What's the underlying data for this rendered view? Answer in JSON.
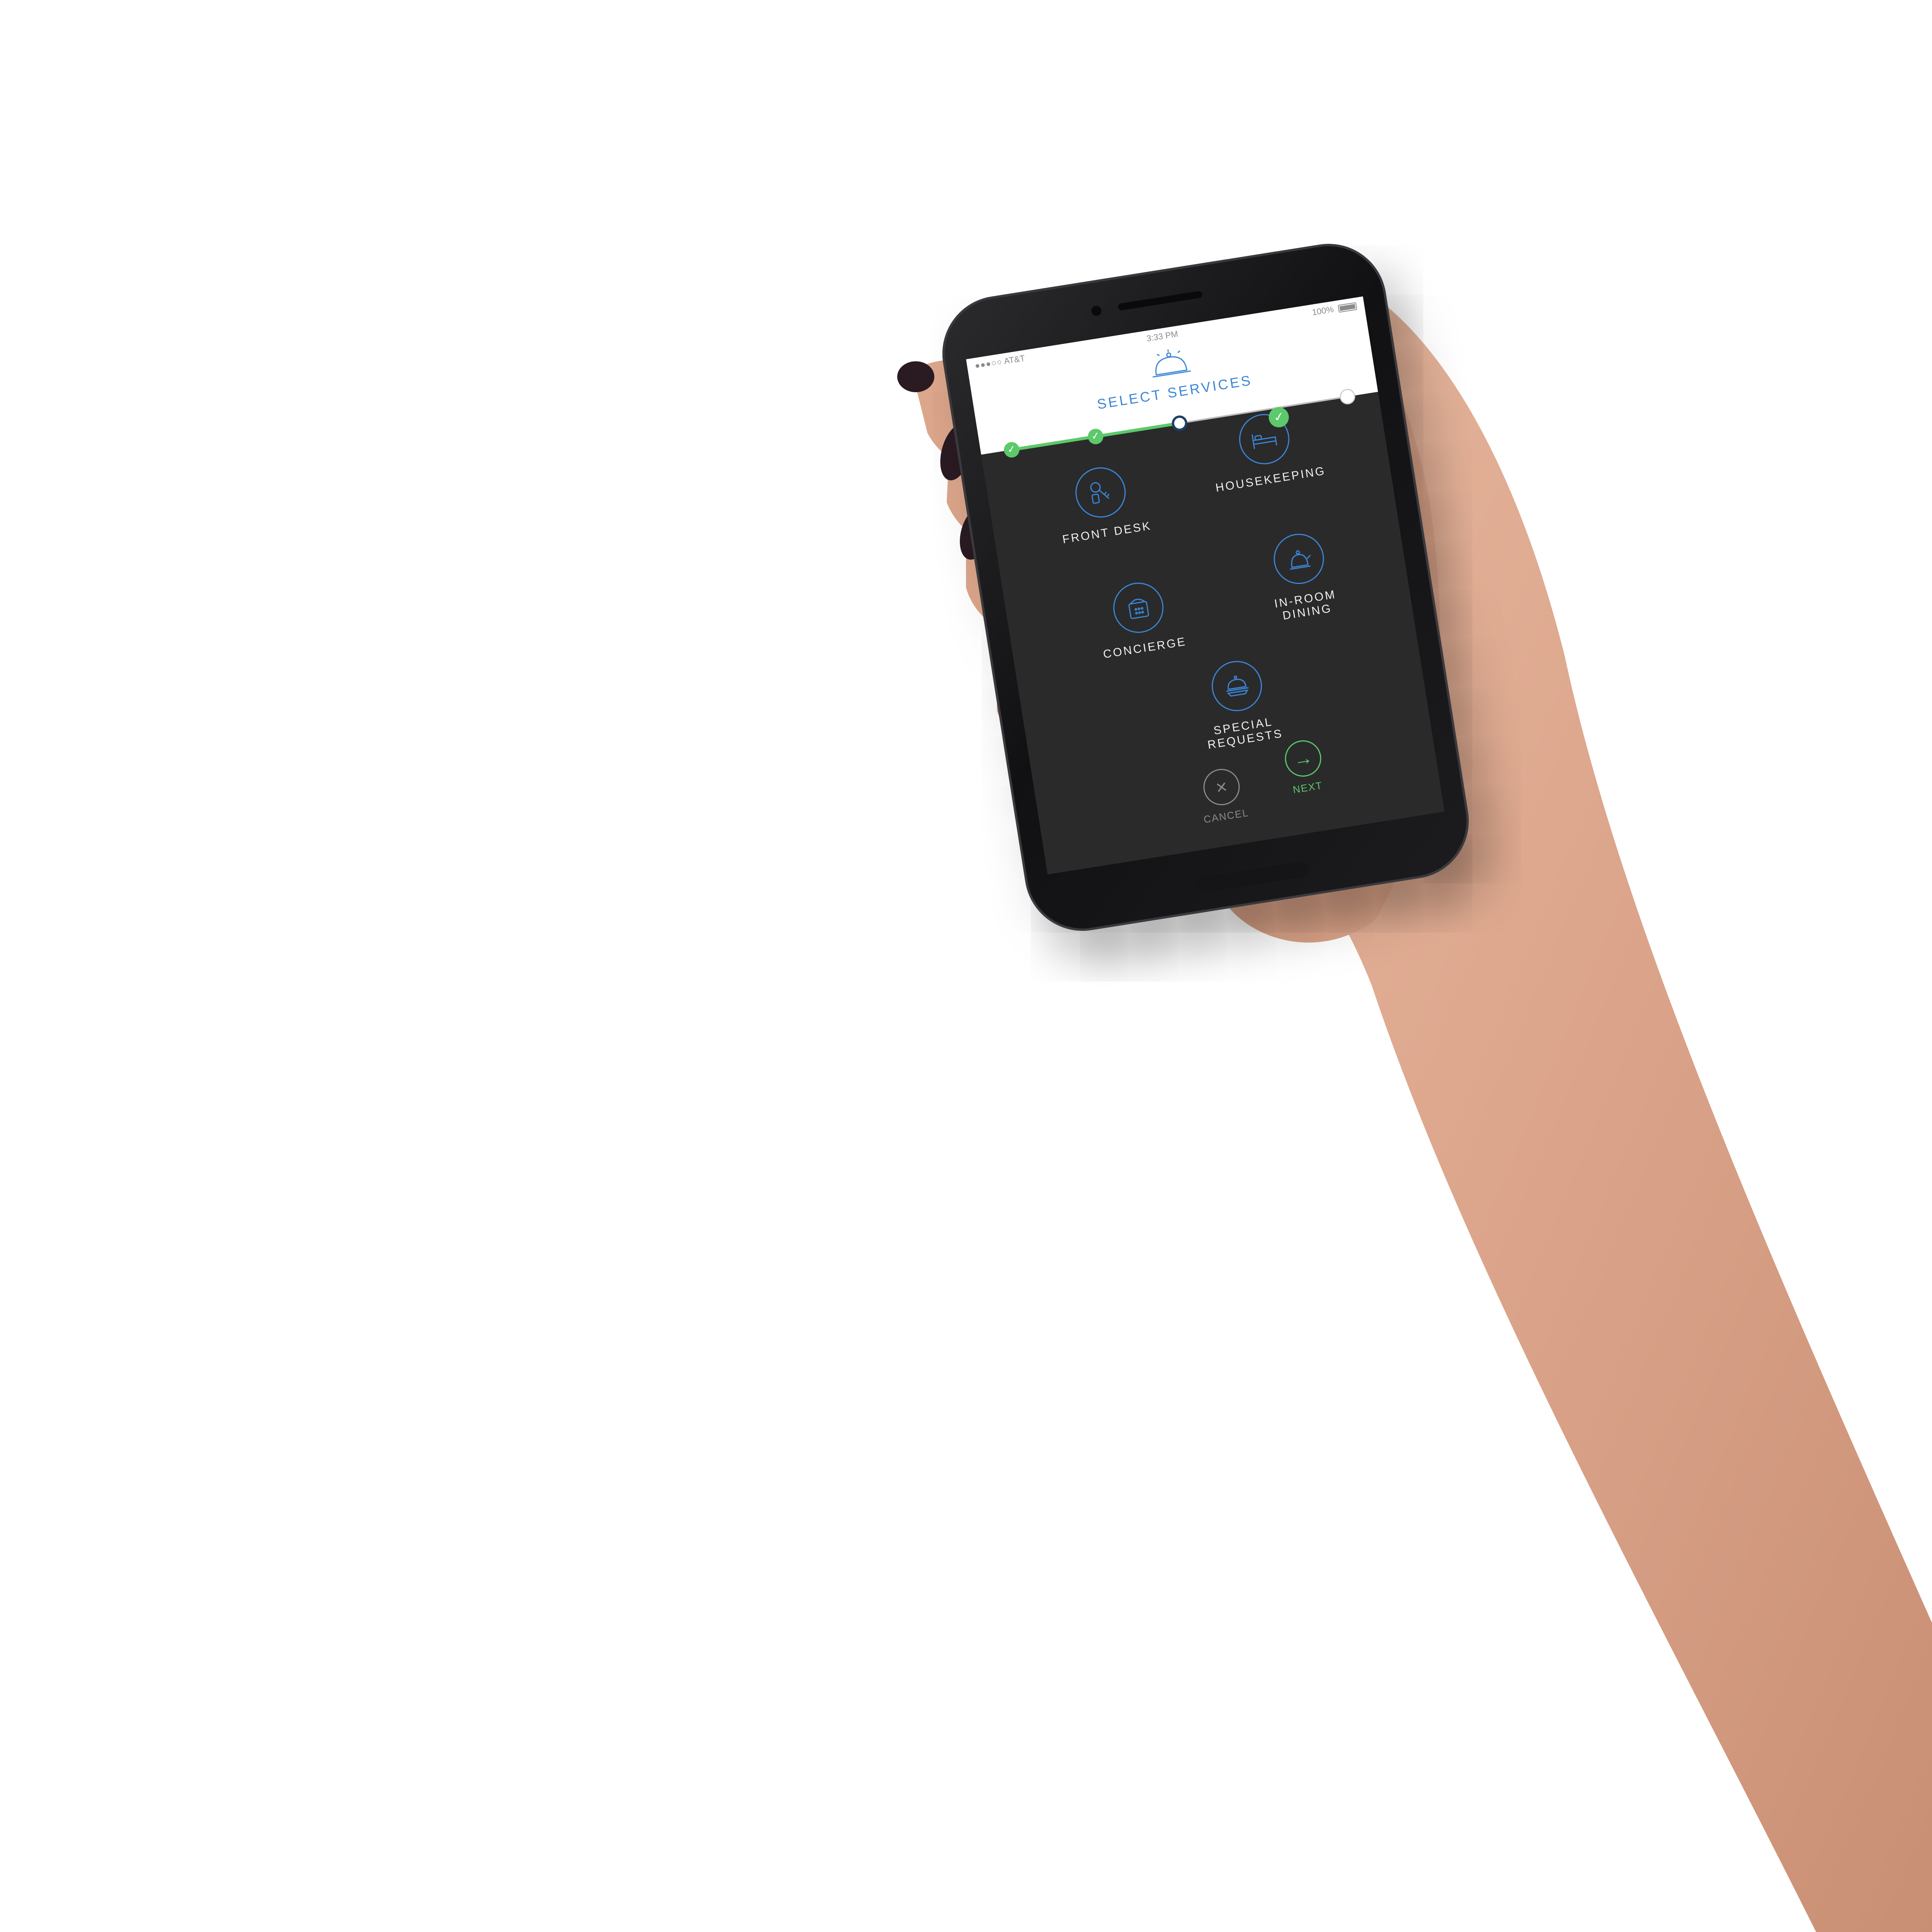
{
  "status_bar": {
    "signal": "●●●○○",
    "carrier": "AT&T",
    "time": "3:33 PM",
    "battery": "100%"
  },
  "header": {
    "title": "SELECT SERVICES",
    "icon": "service-bell-icon"
  },
  "progress": {
    "steps": [
      "done",
      "done",
      "current",
      "todo"
    ],
    "completed_fraction": 0.5
  },
  "services": [
    {
      "label": "FRONT DESK",
      "icon": "keys-icon",
      "selected": false
    },
    {
      "label": "HOUSEKEEPING",
      "icon": "bed-icon",
      "selected": true
    },
    {
      "label": "CONCIERGE",
      "icon": "phone-icon",
      "selected": false
    },
    {
      "label": "IN-ROOM DINING",
      "icon": "tea-kettle-icon",
      "selected": false
    },
    {
      "label": "SPECIAL REQUESTS",
      "icon": "food-tray-icon",
      "selected": false
    }
  ],
  "actions": {
    "cancel_label": "CANCEL",
    "next_label": "NEXT",
    "cancel_icon": "close-icon",
    "next_icon": "arrow-right-icon"
  },
  "colors": {
    "accent_blue": "#3a86d6",
    "success_green": "#5cc96a",
    "screen_bg": "#2a2a2b"
  }
}
